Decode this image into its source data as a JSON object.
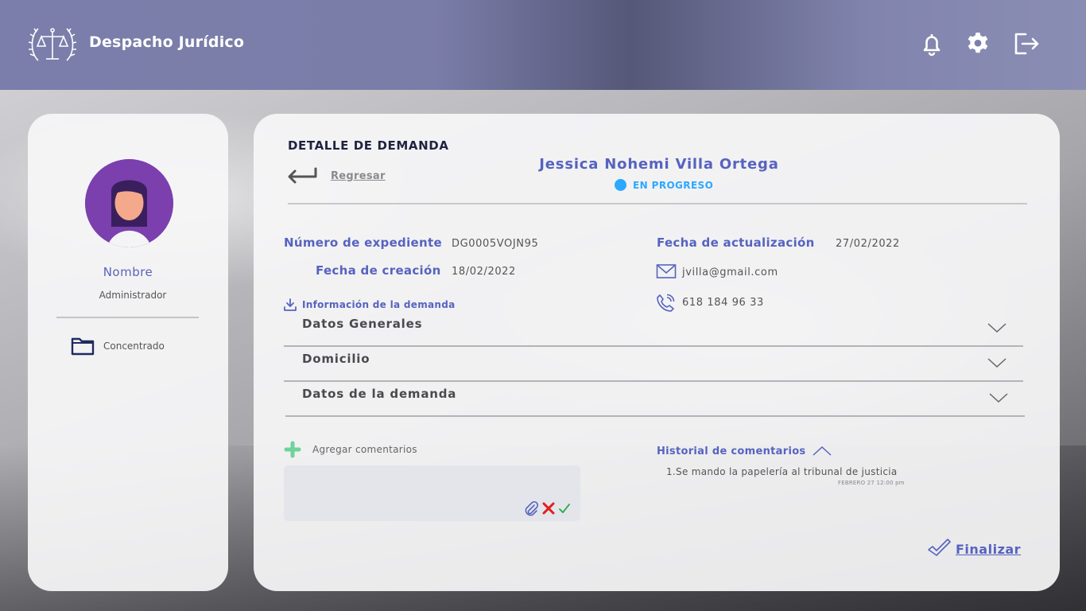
{
  "app": {
    "title": "Despacho Jurídico"
  },
  "header": {
    "icons": [
      "bell-icon",
      "gear-icon",
      "logout-icon"
    ]
  },
  "sidebar": {
    "user_name": "Nombre",
    "user_role": "Administrador",
    "items": [
      {
        "label": "Concentrado",
        "icon": "folder-icon"
      }
    ]
  },
  "main": {
    "section_title": "DETALLE DE DEMANDA",
    "back_label": "Regresar",
    "client_name": "Jessica Nohemi Villa Ortega",
    "status": {
      "label": "EN PROGRESO",
      "color": "#2ba8ff"
    },
    "fields": {
      "expediente_label": "Número de expediente",
      "expediente_value": "DG0005VOJN95",
      "creacion_label": "Fecha de creación",
      "creacion_value": "18/02/2022",
      "actualizacion_label": "Fecha de actualización",
      "actualizacion_value": "27/02/2022",
      "email": "jvilla@gmail.com",
      "phone": "618 184 96 33"
    },
    "info_download_label": "Información de la demanda",
    "sections": [
      {
        "label": "Datos Generales"
      },
      {
        "label": "Domicilio"
      },
      {
        "label": "Datos de la demanda"
      }
    ],
    "comments": {
      "add_label": "Agregar comentarios",
      "history_title": "Historial de comentarios",
      "history": [
        {
          "text": "1.Se mando la papelería al tribunal de justicia",
          "time": "FEBRERO 27 12:00 pm"
        }
      ]
    },
    "finalize_label": "Finalizar"
  },
  "colors": {
    "accent": "#5663bf",
    "header": "#7b7eaa",
    "add": "#6fd39a",
    "cancel": "#e02020",
    "confirm": "#2aa84a"
  }
}
